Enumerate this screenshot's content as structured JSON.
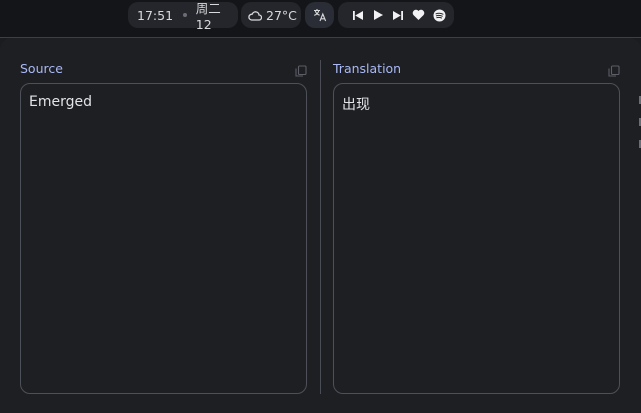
{
  "topbar": {
    "clock": {
      "time": "17:51",
      "date": "周二 12"
    },
    "weather": {
      "icon": "cloud-icon",
      "temp": "27°C"
    },
    "translate_icon": "translate-icon",
    "media": {
      "prev_icon": "skip-previous-icon",
      "play_icon": "play-icon",
      "next_icon": "skip-next-icon",
      "like_icon": "heart-icon",
      "app_icon": "spotify-icon"
    }
  },
  "translator": {
    "source": {
      "label": "Source",
      "text": "Emerged",
      "copy_icon": "copy-icon"
    },
    "target": {
      "label": "Translation",
      "text": "出现",
      "copy_icon": "copy-icon"
    }
  },
  "colors": {
    "background": "#1e1f23",
    "topbar": "#141518",
    "accent_label": "#a9b9f4",
    "border": "#4d5058"
  }
}
